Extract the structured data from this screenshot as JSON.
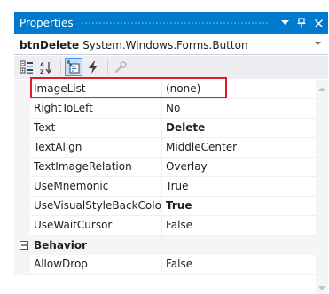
{
  "window": {
    "title": "Properties",
    "buttons": [
      "dropdown",
      "pin",
      "close"
    ],
    "title_bar_color": "#007acc"
  },
  "object_selector": {
    "name": "btnDelete",
    "type": "System.Windows.Forms.Button"
  },
  "toolbar": {
    "tools": [
      "categorized-icon",
      "alphabetical-icon",
      "properties-icon",
      "events-icon",
      "property-pages-icon"
    ]
  },
  "grid": {
    "rows": [
      {
        "name": "ImageList",
        "value": "(none)",
        "bold": false
      },
      {
        "name": "RightToLeft",
        "value": "No",
        "bold": false
      },
      {
        "name": "Text",
        "value": "Delete",
        "bold": true
      },
      {
        "name": "TextAlign",
        "value": "MiddleCenter",
        "bold": false
      },
      {
        "name": "TextImageRelation",
        "value": "Overlay",
        "bold": false
      },
      {
        "name": "UseMnemonic",
        "value": "True",
        "bold": false
      },
      {
        "name": "UseVisualStyleBackColor",
        "value": "True",
        "bold": true
      },
      {
        "name": "UseWaitCursor",
        "value": "False",
        "bold": false
      }
    ],
    "category": {
      "name": "Behavior"
    },
    "after_category": [
      {
        "name": "AllowDrop",
        "value": "False",
        "bold": false
      }
    ],
    "highlight_color": "#e01d25"
  }
}
